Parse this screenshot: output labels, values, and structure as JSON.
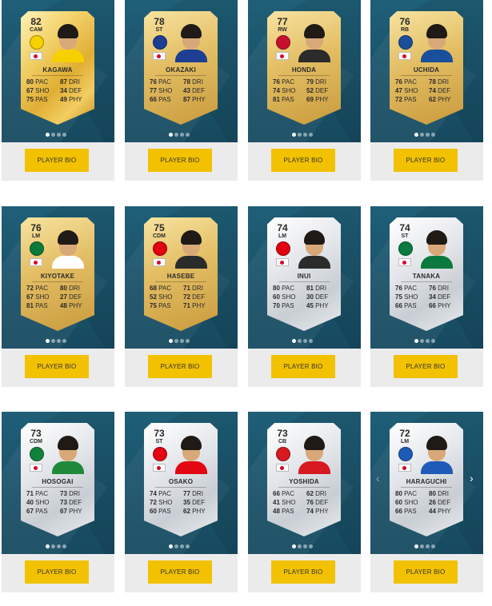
{
  "button_label": "PLAYER BIO",
  "colors": {
    "panel": "#1f5f78",
    "button": "#f2c100",
    "footer": "#ebebeb"
  },
  "nav": {
    "prev_icon": "chevron-left-icon",
    "next_icon": "chevron-right-icon"
  },
  "players": [
    {
      "name": "KAGAWA",
      "rating": "82",
      "position": "CAM",
      "card": "gold shiny",
      "club_color": "#f7d000",
      "shirt": "#f7d000",
      "stats": [
        {
          "v": "80",
          "k": "PAC"
        },
        {
          "v": "87",
          "k": "DRI"
        },
        {
          "v": "67",
          "k": "SHO"
        },
        {
          "v": "34",
          "k": "DEF"
        },
        {
          "v": "75",
          "k": "PAS"
        },
        {
          "v": "49",
          "k": "PHY"
        }
      ]
    },
    {
      "name": "OKAZAKI",
      "rating": "78",
      "position": "ST",
      "card": "gold",
      "club_color": "#1c3f94",
      "shirt": "#1c3f94",
      "stats": [
        {
          "v": "76",
          "k": "PAC"
        },
        {
          "v": "78",
          "k": "DRI"
        },
        {
          "v": "77",
          "k": "SHO"
        },
        {
          "v": "43",
          "k": "DEF"
        },
        {
          "v": "66",
          "k": "PAS"
        },
        {
          "v": "87",
          "k": "PHY"
        }
      ]
    },
    {
      "name": "HONDA",
      "rating": "77",
      "position": "RW",
      "card": "gold",
      "club_color": "#c8102e",
      "shirt": "#2b2b2b",
      "stats": [
        {
          "v": "76",
          "k": "PAC"
        },
        {
          "v": "79",
          "k": "DRI"
        },
        {
          "v": "74",
          "k": "SHO"
        },
        {
          "v": "52",
          "k": "DEF"
        },
        {
          "v": "81",
          "k": "PAS"
        },
        {
          "v": "69",
          "k": "PHY"
        }
      ]
    },
    {
      "name": "UCHIDA",
      "rating": "76",
      "position": "RB",
      "card": "gold",
      "club_color": "#1a4f9c",
      "shirt": "#1a4f9c",
      "stats": [
        {
          "v": "76",
          "k": "PAC"
        },
        {
          "v": "78",
          "k": "DRI"
        },
        {
          "v": "47",
          "k": "SHO"
        },
        {
          "v": "74",
          "k": "DEF"
        },
        {
          "v": "72",
          "k": "PAS"
        },
        {
          "v": "62",
          "k": "PHY"
        }
      ]
    },
    {
      "name": "KIYOTAKE",
      "rating": "76",
      "position": "LM",
      "card": "gold",
      "club_color": "#0b7a3b",
      "shirt": "#ffffff",
      "stats": [
        {
          "v": "72",
          "k": "PAC"
        },
        {
          "v": "80",
          "k": "DRI"
        },
        {
          "v": "67",
          "k": "SHO"
        },
        {
          "v": "27",
          "k": "DEF"
        },
        {
          "v": "81",
          "k": "PAS"
        },
        {
          "v": "48",
          "k": "PHY"
        }
      ]
    },
    {
      "name": "HASEBE",
      "rating": "75",
      "position": "CDM",
      "card": "gold",
      "club_color": "#e1000f",
      "shirt": "#2b2b2b",
      "stats": [
        {
          "v": "68",
          "k": "PAC"
        },
        {
          "v": "71",
          "k": "DRI"
        },
        {
          "v": "52",
          "k": "SHO"
        },
        {
          "v": "72",
          "k": "DEF"
        },
        {
          "v": "75",
          "k": "PAS"
        },
        {
          "v": "71",
          "k": "PHY"
        }
      ]
    },
    {
      "name": "INUI",
      "rating": "74",
      "position": "LM",
      "card": "silver",
      "club_color": "#e1000f",
      "shirt": "#2b2b2b",
      "stats": [
        {
          "v": "80",
          "k": "PAC"
        },
        {
          "v": "81",
          "k": "DRI"
        },
        {
          "v": "60",
          "k": "SHO"
        },
        {
          "v": "30",
          "k": "DEF"
        },
        {
          "v": "70",
          "k": "PAS"
        },
        {
          "v": "45",
          "k": "PHY"
        }
      ]
    },
    {
      "name": "TANAKA",
      "rating": "74",
      "position": "ST",
      "card": "silver",
      "club_color": "#0a7a3f",
      "shirt": "#0a7a3f",
      "stats": [
        {
          "v": "76",
          "k": "PAC"
        },
        {
          "v": "76",
          "k": "DRI"
        },
        {
          "v": "75",
          "k": "SHO"
        },
        {
          "v": "34",
          "k": "DEF"
        },
        {
          "v": "66",
          "k": "PAS"
        },
        {
          "v": "66",
          "k": "PHY"
        }
      ]
    },
    {
      "name": "HOSOGAI",
      "rating": "73",
      "position": "CDM",
      "card": "silver",
      "club_color": "#12813c",
      "shirt": "#1f8a3c",
      "stats": [
        {
          "v": "71",
          "k": "PAC"
        },
        {
          "v": "73",
          "k": "DRI"
        },
        {
          "v": "40",
          "k": "SHO"
        },
        {
          "v": "73",
          "k": "DEF"
        },
        {
          "v": "67",
          "k": "PAS"
        },
        {
          "v": "67",
          "k": "PHY"
        }
      ]
    },
    {
      "name": "OSAKO",
      "rating": "73",
      "position": "ST",
      "card": "silver",
      "club_color": "#e30613",
      "shirt": "#e30613",
      "stats": [
        {
          "v": "74",
          "k": "PAC"
        },
        {
          "v": "77",
          "k": "DRI"
        },
        {
          "v": "72",
          "k": "SHO"
        },
        {
          "v": "35",
          "k": "DEF"
        },
        {
          "v": "60",
          "k": "PAS"
        },
        {
          "v": "62",
          "k": "PHY"
        }
      ]
    },
    {
      "name": "YOSHIDA",
      "rating": "73",
      "position": "CB",
      "card": "silver",
      "club_color": "#d71920",
      "shirt": "#d71920",
      "stats": [
        {
          "v": "66",
          "k": "PAC"
        },
        {
          "v": "62",
          "k": "DRI"
        },
        {
          "v": "41",
          "k": "SHO"
        },
        {
          "v": "76",
          "k": "DEF"
        },
        {
          "v": "48",
          "k": "PAS"
        },
        {
          "v": "74",
          "k": "PHY"
        }
      ]
    },
    {
      "name": "HARAGUCHI",
      "rating": "72",
      "position": "LM",
      "card": "silver",
      "club_color": "#1e5bb8",
      "shirt": "#1e5bb8",
      "stats": [
        {
          "v": "80",
          "k": "PAC"
        },
        {
          "v": "80",
          "k": "DRI"
        },
        {
          "v": "60",
          "k": "SHO"
        },
        {
          "v": "26",
          "k": "DEF"
        },
        {
          "v": "66",
          "k": "PAS"
        },
        {
          "v": "44",
          "k": "PHY"
        }
      ]
    }
  ]
}
